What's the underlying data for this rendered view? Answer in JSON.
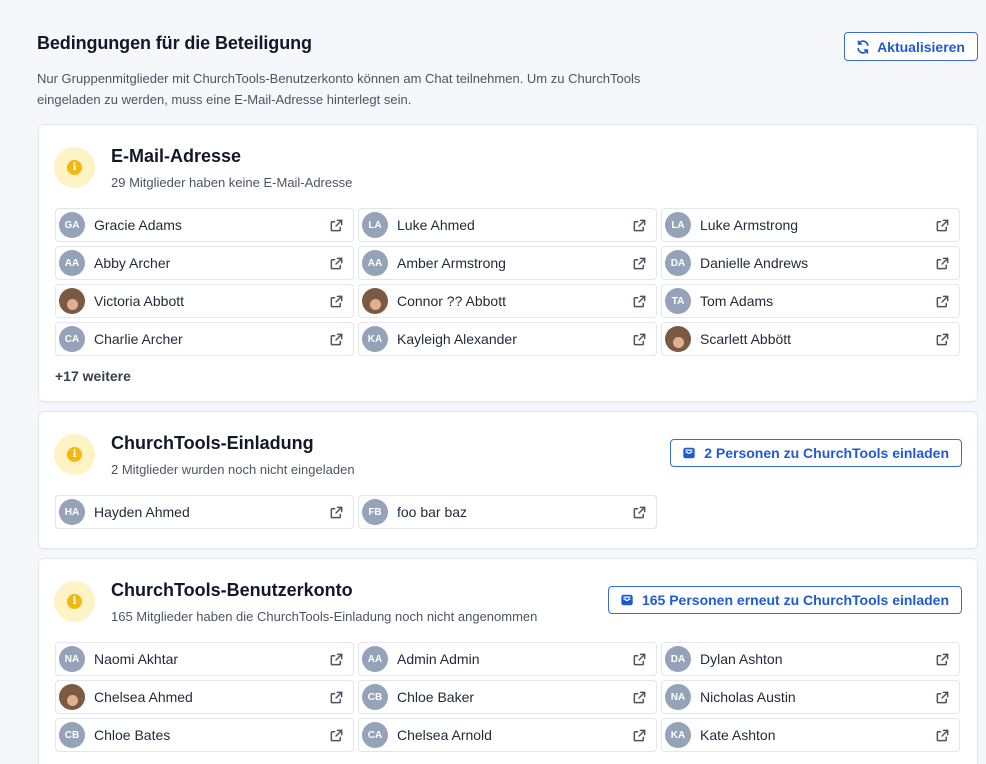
{
  "header": {
    "title": "Bedingungen für die Beteiligung",
    "description": "Nur Gruppenmitglieder mit ChurchTools-Benutzerkonto können am Chat teilnehmen. Um zu ChurchTools eingeladen zu werden, muss eine E-Mail-Adresse hinterlegt sein.",
    "refresh_label": "Aktualisieren"
  },
  "email": {
    "title": "E-Mail-Adresse",
    "subtitle": "29 Mitglieder haben keine E-Mail-Adresse",
    "more": "+17 weitere",
    "members": [
      {
        "initials": "GA",
        "name": "Gracie Adams",
        "photo": false
      },
      {
        "initials": "LA",
        "name": "Luke Ahmed",
        "photo": false
      },
      {
        "initials": "LA",
        "name": "Luke Armstrong",
        "photo": false
      },
      {
        "initials": "AA",
        "name": "Abby Archer",
        "photo": false
      },
      {
        "initials": "AA",
        "name": "Amber Armstrong",
        "photo": false
      },
      {
        "initials": "DA",
        "name": "Danielle Andrews",
        "photo": false
      },
      {
        "initials": "",
        "name": "Victoria Abbott",
        "photo": true
      },
      {
        "initials": "",
        "name": "Connor ?? Abbott",
        "photo": true
      },
      {
        "initials": "TA",
        "name": "Tom Adams",
        "photo": false
      },
      {
        "initials": "CA",
        "name": "Charlie Archer",
        "photo": false
      },
      {
        "initials": "KA",
        "name": "Kayleigh Alexander",
        "photo": false
      },
      {
        "initials": "",
        "name": "Scarlett Abbött",
        "photo": true
      }
    ]
  },
  "invite": {
    "title": "ChurchTools-Einladung",
    "subtitle": "2 Mitglieder wurden noch nicht eingeladen",
    "button": "2 Personen zu ChurchTools einladen",
    "members": [
      {
        "initials": "HA",
        "name": "Hayden Ahmed",
        "photo": false
      },
      {
        "initials": "FB",
        "name": "foo bar baz",
        "photo": false
      }
    ]
  },
  "account": {
    "title": "ChurchTools-Benutzerkonto",
    "subtitle": "165 Mitglieder haben die ChurchTools-Einladung noch nicht angenommen",
    "button": "165 Personen erneut zu ChurchTools einladen",
    "members": [
      {
        "initials": "NA",
        "name": "Naomi Akhtar",
        "photo": false
      },
      {
        "initials": "AA",
        "name": "Admin Admin",
        "photo": false
      },
      {
        "initials": "DA",
        "name": "Dylan Ashton",
        "photo": false
      },
      {
        "initials": "",
        "name": "Chelsea Ahmed",
        "photo": true
      },
      {
        "initials": "CB",
        "name": "Chloe Baker",
        "photo": false
      },
      {
        "initials": "NA",
        "name": "Nicholas Austin",
        "photo": false
      },
      {
        "initials": "CB",
        "name": "Chloe Bates",
        "photo": false
      },
      {
        "initials": "CA",
        "name": "Chelsea Arnold",
        "photo": false
      },
      {
        "initials": "KA",
        "name": "Kate Ashton",
        "photo": false
      }
    ]
  },
  "icons": {
    "refresh": "refresh-icon",
    "info": "info-icon",
    "external": "external-link-icon",
    "invite": "mail-inbox-icon"
  },
  "colors": {
    "accent": "#1f5ad6",
    "info_badge_bg": "#fdf3c4",
    "info_dot": "#f2b80c",
    "avatar_bg": "#94a3b8"
  }
}
